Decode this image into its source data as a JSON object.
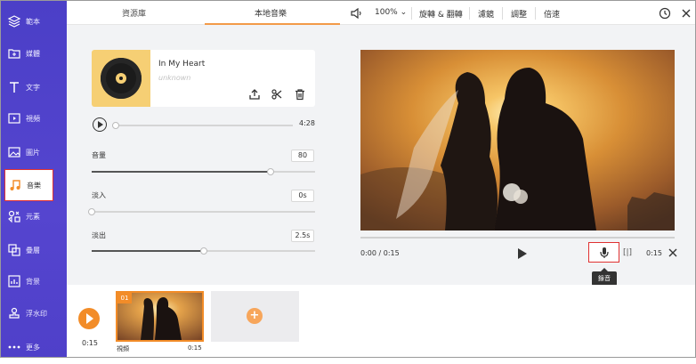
{
  "sidebar": {
    "items": [
      {
        "label": "範本",
        "icon": "layers-icon"
      },
      {
        "label": "媒體",
        "icon": "folder-icon"
      },
      {
        "label": "文字",
        "icon": "text-icon"
      },
      {
        "label": "視頻",
        "icon": "video-icon"
      },
      {
        "label": "圖片",
        "icon": "image-icon"
      },
      {
        "label": "音樂",
        "icon": "music-icon"
      },
      {
        "label": "元素",
        "icon": "elements-icon"
      },
      {
        "label": "疊層",
        "icon": "overlay-icon"
      },
      {
        "label": "背景",
        "icon": "background-icon"
      },
      {
        "label": "浮水印",
        "icon": "watermark-icon"
      },
      {
        "label": "更多",
        "icon": "more-icon"
      }
    ]
  },
  "tabs": [
    "資源庫",
    "本地音樂"
  ],
  "music": {
    "title": "In My Heart",
    "artist": "unknown",
    "duration": "4:28",
    "progress": 0.0
  },
  "controls": [
    {
      "label": "音量",
      "value": "80",
      "level": 0.8
    },
    {
      "label": "淡入",
      "value": "0s",
      "level": 0.0
    },
    {
      "label": "淡出",
      "value": "2.5s",
      "level": 0.5
    }
  ],
  "toolbar": {
    "zoom": "100%",
    "items": [
      "旋轉 & 翻轉",
      "濾鏡",
      "調整",
      "倍速"
    ]
  },
  "player": {
    "time": "0:00 / 0:15",
    "duration": "0:15",
    "tooltip": "錄音"
  },
  "timeline": {
    "time": "0:15",
    "clip_index": "01",
    "clip_label": "視頻",
    "clip_duration": "0:15"
  },
  "colors": {
    "sidebar": "#5044cc",
    "accent": "#f28c28",
    "highlight": "#e03131"
  }
}
